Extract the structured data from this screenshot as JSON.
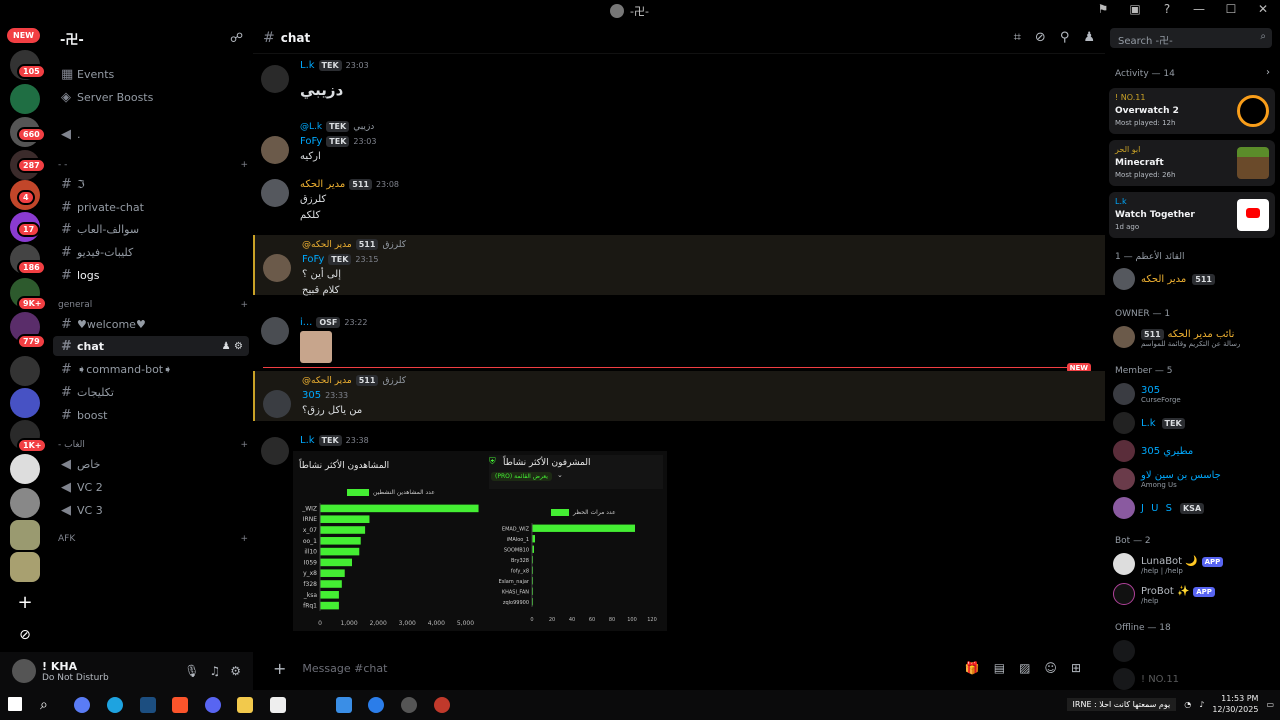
{
  "window": {
    "title": "-卍-"
  },
  "rail": {
    "new_label": "NEW",
    "badges": [
      "105",
      "660",
      "287",
      "4",
      "17",
      "186",
      "9K+",
      "779",
      "1K+"
    ]
  },
  "server": {
    "name": "-卍-"
  },
  "channels": {
    "events": "Events",
    "boosts": "Server Boosts",
    "voice_top": ".",
    "cat1": "- -",
    "c_j": "ℑ",
    "private_chat": "private-chat",
    "ar1": "سوالف-العاب",
    "ar2": "كليبات-فيديو",
    "logs": "logs",
    "cat_general": "general",
    "welcome": "♥welcome♥",
    "chat": "chat",
    "command_bot": "➧command-bot➧",
    "ar3": "تكليجات",
    "boost": "boost",
    "cat_games": "- الغاب",
    "v_khas": "خاص",
    "vc2": "VC 2",
    "vc3": "VC 3",
    "cat_afk": "AFK"
  },
  "user": {
    "name": "! KHA",
    "status": "Do Not Disturb"
  },
  "header": {
    "channel": "chat",
    "search_placeholder": "Search -卍-"
  },
  "messages": [
    {
      "author": "L.k",
      "tag": "TEK",
      "time": "23:03",
      "text": "دزيبي"
    },
    {
      "reply_to": "@L.k",
      "reply_tag": "TEK",
      "reply_text": "دزيبي",
      "author": "FoFy",
      "tag": "TEK",
      "time": "23:03",
      "text": "اركيه"
    },
    {
      "author": "مدير الحكه",
      "tag": "511",
      "time": "23:08",
      "lines": [
        "كلرزق",
        "كلكم"
      ]
    },
    {
      "reply_to": "@مدير الحكه",
      "reply_tag": "511",
      "reply_text": "كلرزق",
      "author": "FoFy",
      "tag": "TEK",
      "time": "23:15",
      "lines": [
        "إلى أين ؟",
        "كلام قبيح"
      ]
    },
    {
      "author": "i...",
      "tag": "OSF",
      "time": "23:22"
    },
    {
      "reply_to": "@مدير الحكه",
      "reply_tag": "511",
      "reply_text": "كلرزق",
      "author": "305",
      "time": "23:33",
      "text": "من ياكل رزق؟"
    },
    {
      "author": "L.k",
      "tag": "TEK",
      "time": "23:38"
    }
  ],
  "new_marker": "NEW",
  "chart_data": [
    {
      "type": "bar",
      "title": "المشاهدون الأكثر نشاطاً",
      "legend": "عدد المشاهدين النشطين",
      "categories": [
        "_WIZ",
        "IRNE",
        "x_07",
        "oo_1",
        "ill10",
        "I059",
        "y_x8",
        "f328",
        "_ksa",
        "fRq1"
      ],
      "values": [
        5450,
        1700,
        1550,
        1400,
        1350,
        1100,
        850,
        750,
        650,
        650
      ],
      "xticks": [
        "0",
        "1,000",
        "2,000",
        "3,000",
        "4,000",
        "5,000"
      ],
      "xlim": [
        0,
        5500
      ]
    },
    {
      "type": "bar",
      "title": "المشرفون الأكثر نشاطاً",
      "badge": "(PRO) يعرض القائمة",
      "legend": "عدد مرات الحظر",
      "categories": [
        "EMAD_WIZ",
        "iMAloo_1",
        "SOOMB10",
        "Bry328",
        "fofy_x8",
        "Eslam_najar",
        "KHASI_FAN",
        "zqlo99900"
      ],
      "values": [
        103,
        3,
        2,
        1,
        1,
        1,
        1,
        1
      ],
      "xticks": [
        "0",
        "20",
        "40",
        "60",
        "80",
        "100",
        "120"
      ],
      "xlim": [
        0,
        125
      ]
    }
  ],
  "members": {
    "activity": "Activity — 14",
    "activities": [
      {
        "who": "! NO.11",
        "game": "Overwatch 2",
        "sub": "Most played: 12h",
        "art": "#f99e1a"
      },
      {
        "who": "ابو الحر",
        "game": "Minecraft",
        "sub": "Most played: 26h",
        "art": "#5b8c2a"
      },
      {
        "who": "L.k",
        "game": "Watch Together",
        "sub": "1d ago",
        "art": "#ff0000"
      }
    ],
    "sec_top": "القائد الأعظم — 1",
    "top_member": {
      "name": "مدير الحكه",
      "tag": "511"
    },
    "sec_owner": "OWNER — 1",
    "owner": {
      "name": "نائب مدير الحكه",
      "tag": "511",
      "status": "رسالة عن التكريم وقائمة للمواسم"
    },
    "sec_member": "Member — 5",
    "member_list": [
      {
        "name": "305",
        "status": "CurseForge",
        "color": "#00a8fc"
      },
      {
        "name": "L.k",
        "tag": "TEK",
        "color": "#00a8fc"
      },
      {
        "name": "305 مطيري",
        "color": "#00a8fc"
      },
      {
        "name": "جاسس بن سين لاو",
        "status": "Among Us",
        "color": "#00a8fc"
      },
      {
        "name": "J U S",
        "tag": "KSA",
        "color": "#00a8fc"
      }
    ],
    "sec_bot": "Bot — 2",
    "bots": [
      {
        "name": "LunaBot 🌙",
        "badge": "APP",
        "status": "/help | /help"
      },
      {
        "name": "ProBot ✨",
        "badge": "APP",
        "status": "/help"
      }
    ],
    "sec_offline": "Offline — 18",
    "offline": [
      "! NO.11"
    ]
  },
  "composer": {
    "placeholder": "Message #chat"
  },
  "taskbar": {
    "ticker": "IRNE : يوم سمعتها كانت احلا",
    "time": "11:53 PM",
    "date": "12/30/2025"
  }
}
